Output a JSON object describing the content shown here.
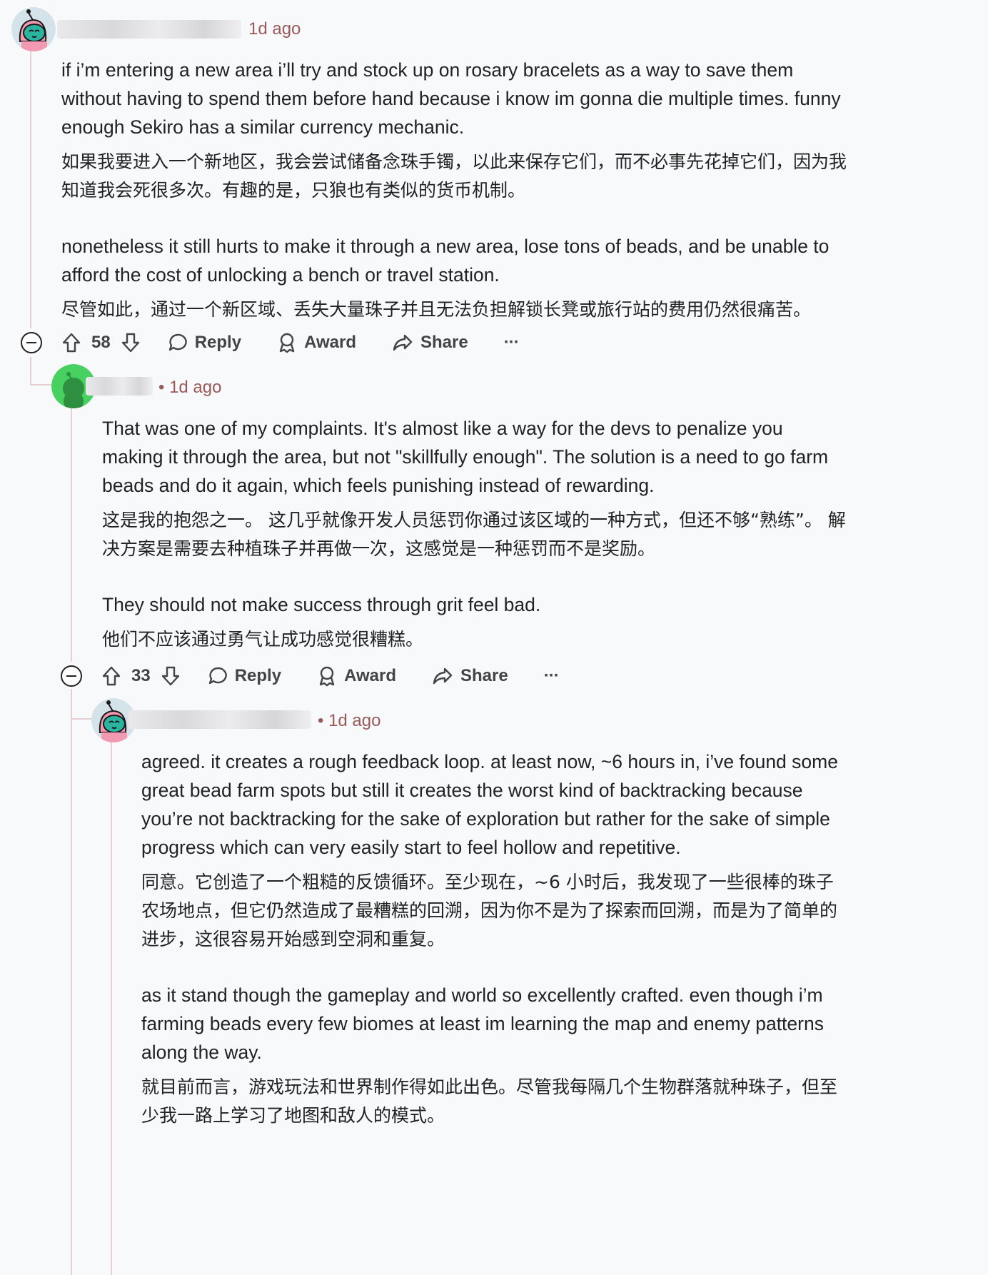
{
  "comments": [
    {
      "timestamp": "1d ago",
      "paragraphs": [
        "if i’m entering a new area i’ll try and stock up on rosary bracelets as a way to save them without having to spend them before hand because i know im gonna die multiple times. funny enough Sekiro has a similar currency mechanic.",
        "如果我要进入一个新地区，我会尝试储备念珠手镯，以此来保存它们，而不必事先花掉它们，因为我知道我会死很多次。有趣的是，只狼也有类似的货币机制。",
        "nonetheless it still hurts to make it through a new area, lose tons of beads, and be unable to afford the cost of unlocking a bench or travel station.",
        "尽管如此，通过一个新区域、丢失大量珠子并且无法负担解锁长凳或旅行站的费用仍然很痛苦。"
      ],
      "votes": "58"
    },
    {
      "timestamp": "• 1d ago",
      "paragraphs": [
        "That was one of my complaints.  It's almost like a way for the devs to penalize you making it through the area, but not \"skillfully enough\".  The solution is a need to go farm beads and do it again, which feels punishing instead of rewarding.",
        "这是我的抱怨之一。 这几乎就像开发人员惩罚你通过该区域的一种方式，但还不够“熟练”。 解决方案是需要去种植珠子并再做一次，这感觉是一种惩罚而不是奖励。",
        "They should not make success through grit feel bad.",
        "他们不应该通过勇气让成功感觉很糟糕。"
      ],
      "votes": "33"
    },
    {
      "timestamp": "• 1d ago",
      "paragraphs": [
        "agreed. it creates a rough feedback loop. at least now, ~6 hours in, i’ve found some great bead farm spots but still it creates the worst kind of backtracking because you’re not backtracking for the sake of exploration but rather for the sake of simple progress which can very easily start to feel hollow and repetitive.",
        "同意。它创造了一个粗糙的反馈循环。至少现在，~6 小时后，我发现了一些很棒的珠子农场地点，但它仍然造成了最糟糕的回溯，因为你不是为了探索而回溯，而是为了简单的进步，这很容易开始感到空洞和重复。",
        "as it stand though the gameplay and world so excellently crafted. even though i’m farming beads every few biomes at least im learning the map and enemy patterns along the way.",
        "就目前而言，游戏玩法和世界制作得如此出色。尽管我每隔几个生物群落就种珠子，但至少我一路上学习了地图和敌人的模式。"
      ]
    }
  ],
  "actions": {
    "reply": "Reply",
    "award": "Award",
    "share": "Share",
    "more": "···"
  },
  "icons": {
    "upvote": "upvote-arrow-icon",
    "downvote": "downvote-arrow-icon",
    "reply": "speech-bubble-icon",
    "award": "award-ribbon-icon",
    "share": "share-arrow-icon",
    "collapse": "collapse-minus-icon"
  },
  "colors": {
    "timestamp": "#9b5a5a",
    "thread_line": "#e6d0d3",
    "avatar_green": "#46d160"
  }
}
